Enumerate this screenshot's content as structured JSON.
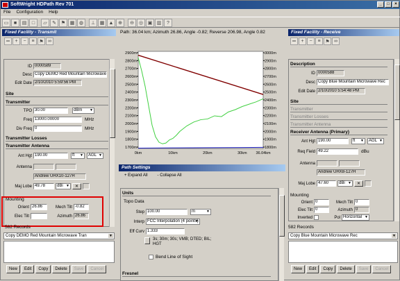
{
  "window": {
    "title": "SoftWright HDPath Rev 701"
  },
  "menu": [
    "File",
    "Configuration",
    "Help"
  ],
  "path_info": "Path: 36.04 km; Azimuth 26.86, Angle -0.82; Reverse 206.98, Angle 0.82",
  "left": {
    "header": "Fixed Facility - Transmit",
    "id_label": "ID",
    "id_value": "0000589",
    "desc_label": "Desc",
    "desc_value": "Copy DEMO Red Mountain Microwave",
    "editdate_label": "Edit Date",
    "editdate_value": "2/10/2010 5:59:56 PM",
    "site_section": "Site",
    "transmitter_section": "Transmitter",
    "tpo_label": "TPO",
    "tpo_value": "30.00",
    "tpo_unit": "dBm",
    "freq_label": "Freq",
    "freq_value": "13000.00000",
    "freq_unit": "MHz",
    "divfreq_label": "Div Freq",
    "divfreq_value": "0",
    "divfreq_unit": "MHz",
    "losses_section": "Transmitter Losses",
    "antenna_section": "Transmitter Antenna",
    "anthgt_label": "Ant Hgt",
    "anthgt_value": "190.00",
    "anthgt_unit": "ft",
    "anthgt_ref": "AGL",
    "antenna_label": "Antenna",
    "antenna_value": "Andrew UHX10-127H",
    "majlobe_label": "Maj Lobe",
    "majlobe_value": "49.78",
    "majlobe_unit": "dBi",
    "mounting_label": "Mounting",
    "orient_label": "Orient",
    "orient_value": "26.86",
    "mechtilt_label": "Mech Tilt",
    "mechtilt_value": "-0.82",
    "electilt_label": "Elec Tilt",
    "azimuth_label": "Azimuth",
    "azimuth_value": "26.86",
    "records": "582 Records",
    "combo_value": "Copy DEMO Red Mountain Microwave Tran"
  },
  "right": {
    "header": "Fixed Facility - Receive",
    "desc_section": "Description",
    "id_label": "ID",
    "id_value": "0000588",
    "desc_label": "Desc",
    "desc_value": "Copy Blue Mountain Microwave Rec",
    "editdate_label": "Edit Date",
    "editdate_value": "2/10/2010 5:54:48 PM",
    "site_section": "Site",
    "transmitter_section": "Transmitter",
    "losses_section": "Transmitter Losses",
    "txantenna_section": "Transmitter Antenna",
    "rxantenna_section": "Receiver Antenna (Primary)",
    "anthgt_label": "Ant Hgt",
    "anthgt_value": "190.00",
    "anthgt_unit": "ft",
    "anthgt_ref": "AGL",
    "reqfield_label": "Req Field",
    "reqfield_value": "49.22",
    "reqfield_unit": "dBu",
    "antenna_label": "Antenna",
    "antenna_value": "Andrew UHX8-127H",
    "majlobe_label": "Maj Lobe",
    "majlobe_value": "47.60",
    "majlobe_unit": "dBi",
    "mounting_label": "Mounting",
    "orient_label": "Orient",
    "orient_value": "0",
    "mechtilt_label": "Mech Tilt",
    "mechtilt_value": "0",
    "electilt_label": "Elec Tilt",
    "electilt_value": "0",
    "azimuth_label": "Azimuth",
    "azimuth_value": "0",
    "inverted_label": "Inverted",
    "pol_label": "Pol",
    "pol_value": "Horizontal",
    "records": "582 Records",
    "combo_value": "Copy Blue Mountain Microwave Rec"
  },
  "buttons": {
    "new": "New",
    "edit": "Edit",
    "copy": "Copy",
    "delete": "Delete",
    "save": "Save",
    "cancel": "Cancel"
  },
  "path_settings": {
    "header": "Path Settings",
    "expand": "+ Expand All",
    "collapse": "- Collapse All",
    "units_section": "Units",
    "topo_section": "Topo Data",
    "step_label": "Step",
    "step_value": "100.00",
    "step_unit": "m",
    "interp_label": "Interp",
    "interp_value": "FCC Interpolation (4 points)",
    "effcurv_label": "Eff Curv",
    "effcurv_value": "1.333",
    "data_sources": "3s; 30m; 30s; VMB; DTED; BIL; HGT",
    "bend_label": "Bend Line of Sight",
    "fresnel_section": "Fresnel"
  },
  "chart_data": {
    "type": "line",
    "xlabel": "",
    "ylabel": "",
    "x_ticks": [
      "0km",
      "10km",
      "20km",
      "30km",
      "36.04km"
    ],
    "x_range": [
      0,
      36.04
    ],
    "y_ticks_left": [
      "2900m",
      "2800m",
      "2700m",
      "2600m",
      "2500m",
      "2400m",
      "2300m",
      "2200m",
      "2100m",
      "2000m",
      "1900m",
      "1800m",
      "1700m"
    ],
    "y_ticks_right": [
      "3000m",
      "2900m",
      "2800m",
      "2700m",
      "2600m",
      "2500m",
      "2400m",
      "2300m",
      "2200m",
      "2100m",
      "2000m",
      "1900m",
      "1800m"
    ],
    "y_range": [
      1700,
      2950
    ],
    "series": [
      {
        "color": "#800000",
        "x": [
          0,
          36.04
        ],
        "y": [
          2900,
          2395
        ]
      },
      {
        "color": "#40d040",
        "x": [
          0,
          1,
          2,
          3,
          4,
          5,
          6,
          7,
          8,
          9,
          10,
          11,
          12,
          14,
          16,
          18,
          20,
          22,
          24,
          26,
          28,
          30,
          32,
          34,
          36.04
        ],
        "y": [
          2870,
          2700,
          2500,
          2250,
          2000,
          1850,
          1780,
          1760,
          1770,
          1810,
          1830,
          1870,
          1920,
          1990,
          2040,
          2070,
          2080,
          2120,
          2110,
          2170,
          2200,
          2240,
          2270,
          2300,
          2340
        ]
      },
      {
        "color": "#2020c0",
        "x": [
          0,
          10,
          20,
          30,
          36.04
        ],
        "y": [
          1705,
          1708,
          1710,
          1712,
          1715
        ]
      }
    ],
    "grid": false
  }
}
